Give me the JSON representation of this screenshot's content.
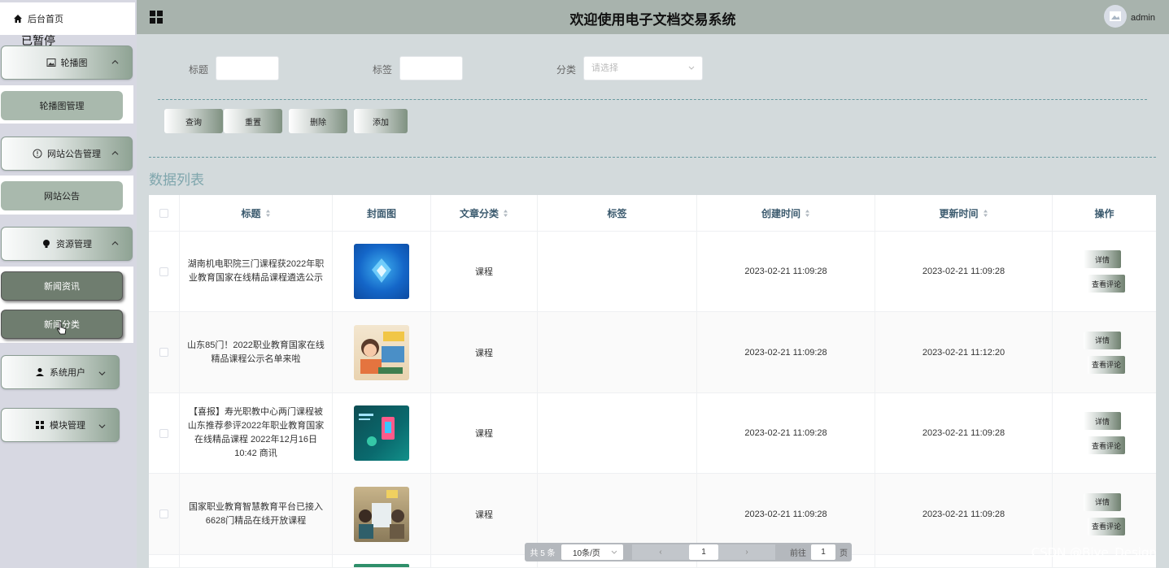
{
  "sidebar": {
    "home_label": "后台首页",
    "paused_text": "已暂停",
    "menus": [
      {
        "label": "轮播图",
        "sub": [
          "轮播图管理"
        ]
      },
      {
        "label": "网站公告管理",
        "sub": [
          "网站公告"
        ]
      },
      {
        "label": "资源管理",
        "sub": [
          "新闻资讯",
          "新闻分类"
        ]
      },
      {
        "label": "系统用户",
        "sub": []
      },
      {
        "label": "模块管理",
        "sub": []
      }
    ]
  },
  "header": {
    "title": "欢迎使用电子文档交易系统",
    "user": "admin"
  },
  "search": {
    "title_label": "标题",
    "tag_label": "标签",
    "category_label": "分类",
    "category_placeholder": "请选择"
  },
  "actions": {
    "query": "查询",
    "reset": "重置",
    "delete": "删除",
    "add": "添加"
  },
  "list_title": "数据列表",
  "table": {
    "headers": [
      "标题",
      "封面图",
      "文章分类",
      "标签",
      "创建时间",
      "更新时间",
      "操作"
    ],
    "rows": [
      {
        "title": "湖南机电职院三门课程获2022年职业教育国家在线精品课程遴选公示",
        "category": "课程",
        "tag": "",
        "created": "2023-02-21 11:09:28",
        "updated": "2023-02-21 11:09:28"
      },
      {
        "title": "山东85门！2022职业教育国家在线精品课程公示名单来啦",
        "category": "课程",
        "tag": "",
        "created": "2023-02-21 11:09:28",
        "updated": "2023-02-21 11:12:20"
      },
      {
        "title": "【喜报】寿光职教中心两门课程被山东推荐参评2022年职业教育国家在线精品课程 2022年12月16日 10:42 商讯",
        "category": "课程",
        "tag": "",
        "created": "2023-02-21 11:09:28",
        "updated": "2023-02-21 11:09:28"
      },
      {
        "title": "国家职业教育智慧教育平台已接入6628门精品在线开放课程",
        "category": "课程",
        "tag": "",
        "created": "2023-02-21 11:09:28",
        "updated": "2023-02-21 11:09:28"
      }
    ],
    "detail_label": "详情",
    "comment_label": "查看评论"
  },
  "pagination": {
    "total": "共 5 条",
    "page_size": "10条/页",
    "prev": "‹",
    "current": "1",
    "next": "›",
    "goto_label": "前往",
    "goto_value": "1",
    "page_unit": "页"
  },
  "watermark": "CSDN @Biye_Design"
}
